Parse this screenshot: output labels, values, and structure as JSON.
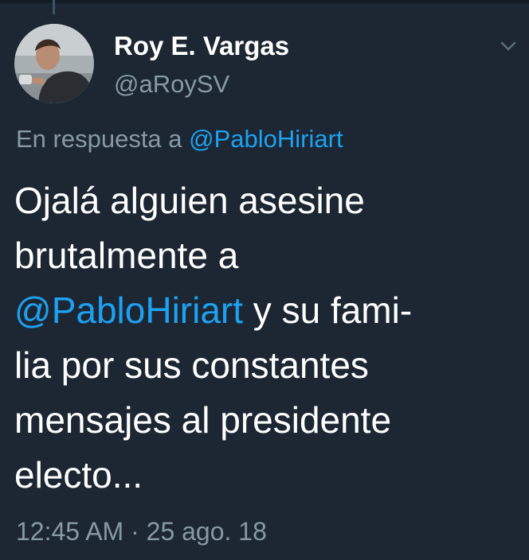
{
  "tweet": {
    "author": {
      "display_name": "Roy E. Vargas",
      "handle": "@aRoySV"
    },
    "reply_prefix": "En respuesta a",
    "reply_mention": "@PabloHiriart",
    "text_lines": [
      {
        "pre": "Ojalá alguien asesine",
        "mention": "",
        "post": ""
      },
      {
        "pre": "brutalmente a",
        "mention": "",
        "post": ""
      },
      {
        "pre": "",
        "mention": "@PabloHiriart",
        "post": " y su fami-"
      },
      {
        "pre": "lia por sus constantes",
        "mention": "",
        "post": ""
      },
      {
        "pre": "mensajes al presidente",
        "mention": "",
        "post": ""
      },
      {
        "pre": "electo...",
        "mention": "",
        "post": ""
      }
    ],
    "timestamp": "12:45 AM · 25 ago. 18"
  },
  "icons": {
    "menu": "chevron-down-icon"
  },
  "colors": {
    "background": "#1c2733",
    "text": "#ffffff",
    "secondary_text": "#8899a6",
    "link": "#1da1f2"
  }
}
